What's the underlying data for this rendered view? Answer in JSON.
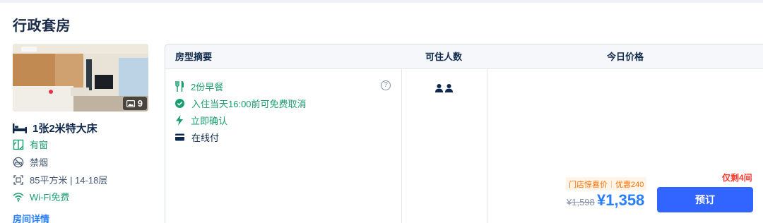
{
  "room": {
    "title": "行政套房",
    "photo_count": "9",
    "bed": "1张2米特大床",
    "features": {
      "window": "有窗",
      "smoking": "禁烟",
      "area_floor": "85平方米 | 14-18层",
      "wifi": "Wi-Fi免费"
    },
    "details_link": "房间详情"
  },
  "table": {
    "headers": {
      "summary": "房型摘要",
      "occupancy": "可住人数",
      "price": "今日价格"
    },
    "perks": {
      "breakfast": "2份早餐",
      "cancellation": "入住当天16:00前可免费取消",
      "confirm": "立即确认",
      "payment": "在线付"
    },
    "help_glyph": "?"
  },
  "offer": {
    "remaining": "仅剩4间",
    "promo_label": "门店惊喜价",
    "discount": "优惠240",
    "original_price": "¥1,598",
    "price": "¥1,358",
    "book_label": "预订"
  },
  "colors": {
    "accent_blue": "#287dfa",
    "button_blue": "#3264ff",
    "perk_green": "#1a9e6e",
    "alert_red": "#ff3b2f",
    "promo_orange": "#ff6f00"
  }
}
